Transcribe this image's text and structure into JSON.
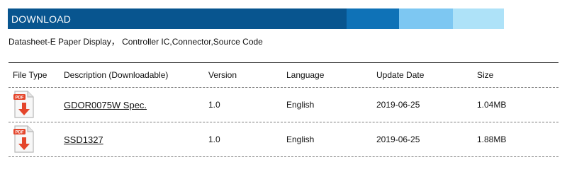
{
  "header": {
    "title": "DOWNLOAD",
    "colors": {
      "main": "#08558f",
      "accent_2": "#0f72b7",
      "accent_3": "#7dc7f2",
      "accent_4": "#aee2f8"
    }
  },
  "subtitle": "Datasheet-E Paper Display， Controller IC,Connector,Source Code",
  "table": {
    "columns": {
      "file_type": "File Type",
      "description": "Description (Downloadable)",
      "version": "Version",
      "language": "Language",
      "update_date": "Update Date",
      "size": "Size"
    },
    "rows": [
      {
        "icon": "pdf-download-icon",
        "description": "GDOR0075W Spec.",
        "version": "1.0",
        "language": "English",
        "update_date": "2019-06-25",
        "size": "1.04MB"
      },
      {
        "icon": "pdf-download-icon",
        "description": "SSD1327",
        "version": "1.0",
        "language": "English",
        "update_date": "2019-06-25",
        "size": "1.88MB"
      }
    ]
  }
}
